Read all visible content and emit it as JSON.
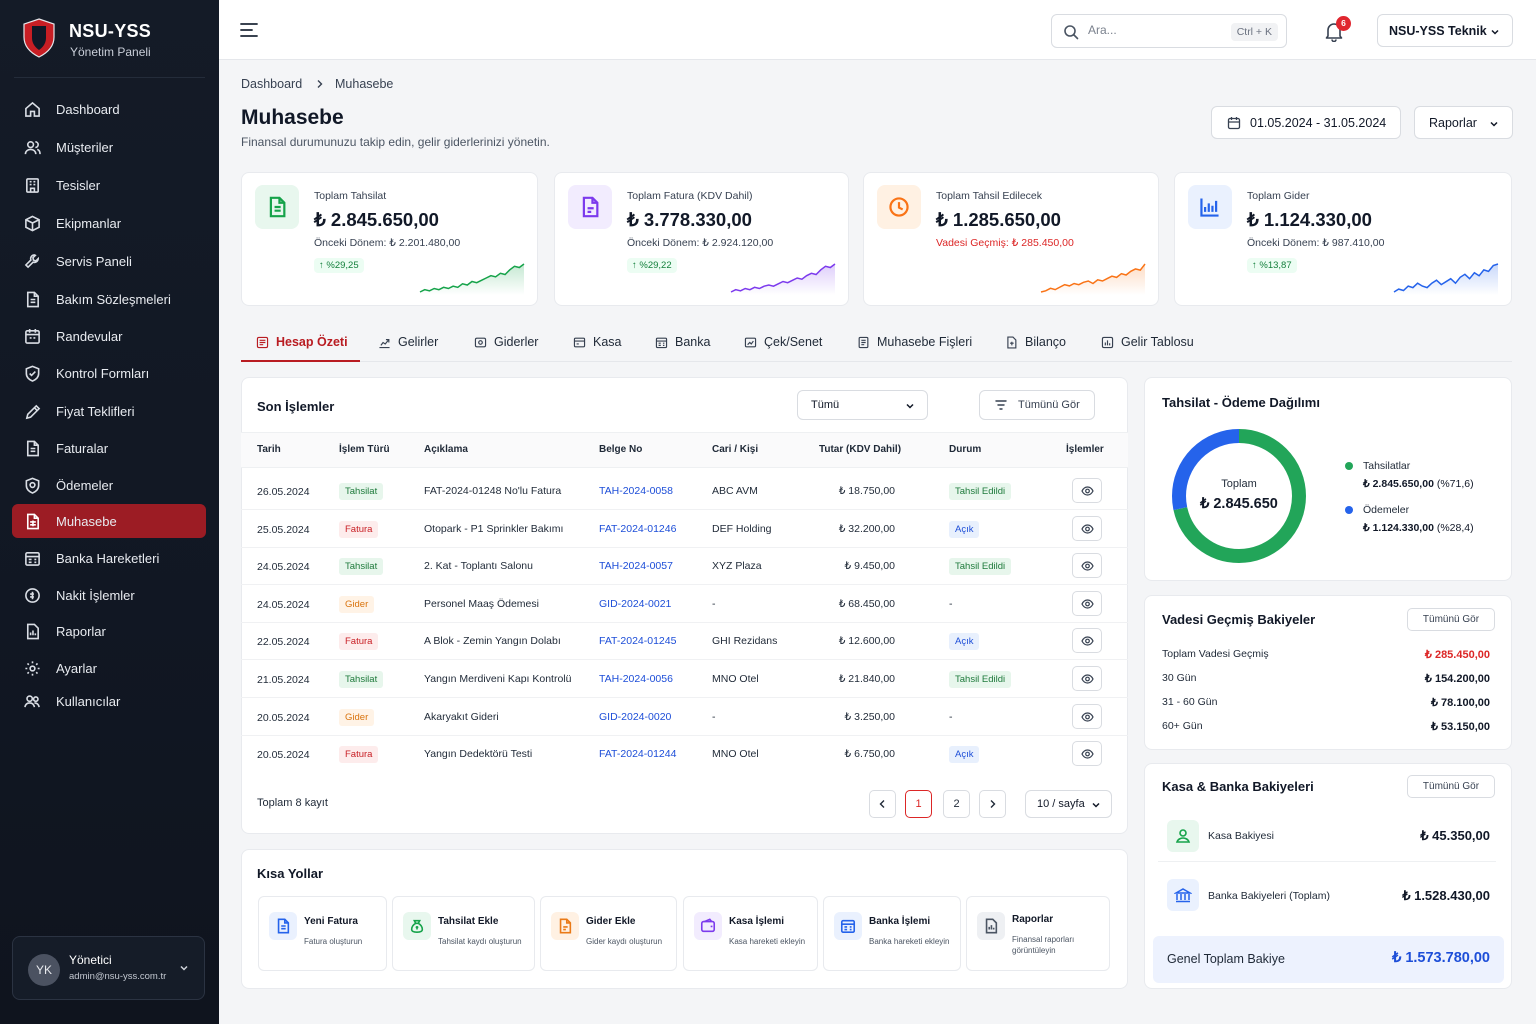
{
  "brand": {
    "name": "NSU-YSS",
    "subtitle": "Yönetim Paneli"
  },
  "sidebar": {
    "items": [
      {
        "label": "Dashboard",
        "icon": "home-icon"
      },
      {
        "label": "Müşteriler",
        "icon": "users-icon"
      },
      {
        "label": "Tesisler",
        "icon": "building-icon"
      },
      {
        "label": "Ekipmanlar",
        "icon": "box-icon"
      },
      {
        "label": "Servis Paneli",
        "icon": "wrench-icon"
      },
      {
        "label": "Bakım Sözleşmeleri",
        "icon": "contract-icon"
      },
      {
        "label": "Randevular",
        "icon": "calendar-icon"
      },
      {
        "label": "Kontrol Formları",
        "icon": "shield-check-icon"
      },
      {
        "label": "Fiyat Teklifleri",
        "icon": "quote-icon"
      },
      {
        "label": "Faturalar",
        "icon": "invoice-icon"
      },
      {
        "label": "Ödemeler",
        "icon": "payment-icon"
      },
      {
        "label": "Muhasebe",
        "icon": "accounting-icon",
        "active": true
      },
      {
        "label": "Banka Hareketleri",
        "icon": "bank-icon"
      },
      {
        "label": "Nakit İşlemler",
        "icon": "cash-icon"
      },
      {
        "label": "Raporlar",
        "icon": "report-icon"
      },
      {
        "label": "Ayarlar",
        "icon": "gear-icon"
      },
      {
        "label": "Kullanıcılar",
        "icon": "user-group-icon"
      }
    ]
  },
  "user": {
    "initials": "YK",
    "name": "Yönetici",
    "email": "admin@nsu-yss.com.tr"
  },
  "topbar": {
    "search_placeholder": "Ara...",
    "shortcut": "Ctrl + K",
    "notifications": "6",
    "account": "NSU-YSS Teknik"
  },
  "breadcrumb": {
    "root": "Dashboard",
    "current": "Muhasebe"
  },
  "page": {
    "title": "Muhasebe",
    "subtitle": "Finansal durumunuzu takip edin, gelir giderlerinizi yönetin.",
    "date_range": "01.05.2024 - 31.05.2024",
    "reports_label": "Raporlar"
  },
  "kpis": [
    {
      "label": "Toplam Tahsilat",
      "value": "₺ 2.845.650,00",
      "prev_label": "Önceki Dönem:",
      "prev_value": "₺ 2.201.480,00",
      "delta": "%29,25",
      "color": "#16a34a",
      "spark": [
        4,
        6,
        5,
        7,
        6,
        8,
        7,
        9,
        8,
        11,
        10,
        13,
        12,
        14,
        16,
        18,
        17,
        20,
        19,
        23,
        26,
        25,
        28
      ]
    },
    {
      "label": "Toplam Fatura (KDV Dahil)",
      "value": "₺ 3.778.330,00",
      "prev_label": "Önceki Dönem:",
      "prev_value": "₺ 2.924.120,00",
      "delta": "%29,22",
      "color": "#7c3aed",
      "spark": [
        3,
        5,
        4,
        6,
        5,
        7,
        6,
        8,
        9,
        8,
        10,
        12,
        11,
        13,
        15,
        14,
        17,
        19,
        18,
        22,
        25,
        24,
        27
      ]
    },
    {
      "label": "Toplam Tahsil Edilecek",
      "value": "₺ 1.285.650,00",
      "prev_label": "Vadesi Geçmiş:",
      "prev_value": "₺ 285.450,00",
      "delta": "",
      "color": "#f97316",
      "spark": [
        3,
        4,
        6,
        5,
        7,
        9,
        8,
        10,
        9,
        11,
        12,
        10,
        13,
        12,
        14,
        16,
        15,
        18,
        17,
        20,
        22,
        21,
        26
      ]
    },
    {
      "label": "Toplam Gider",
      "value": "₺ 1.124.330,00",
      "prev_label": "Önceki Dönem:",
      "prev_value": "₺ 987.410,00",
      "delta": "%13,87",
      "color": "#2563eb",
      "spark": [
        6,
        8,
        7,
        10,
        9,
        12,
        10,
        9,
        12,
        14,
        11,
        13,
        15,
        12,
        16,
        18,
        15,
        19,
        17,
        21,
        20,
        24,
        25
      ]
    }
  ],
  "tabs": [
    {
      "label": "Hesap Özeti",
      "icon": "summary-icon",
      "active": true
    },
    {
      "label": "Gelirler",
      "icon": "income-icon"
    },
    {
      "label": "Giderler",
      "icon": "expense-icon"
    },
    {
      "label": "Kasa",
      "icon": "safe-icon"
    },
    {
      "label": "Banka",
      "icon": "bank-icon"
    },
    {
      "label": "Çek/Senet",
      "icon": "check-icon"
    },
    {
      "label": "Muhasebe Fişleri",
      "icon": "voucher-icon"
    },
    {
      "label": "Bilanço",
      "icon": "balance-icon"
    },
    {
      "label": "Gelir Tablosu",
      "icon": "income-statement-icon"
    }
  ],
  "transactions": {
    "title": "Son İşlemler",
    "filter_value": "Tümü",
    "view_all": "Tümünü Gör",
    "columns": [
      "Tarih",
      "İşlem Türü",
      "Açıklama",
      "Belge No",
      "Cari / Kişi",
      "Tutar (KDV Dahil)",
      "Durum",
      "İşlemler"
    ],
    "rows": [
      {
        "date": "26.05.2024",
        "type": "Tahsilat",
        "type_color": "green",
        "desc": "FAT-2024-01248 No'lu Fatura",
        "doc": "TAH-2024-0058",
        "party": "ABC AVM",
        "amount": "₺ 18.750,00",
        "status": "Tahsil Edildi",
        "status_color": "green"
      },
      {
        "date": "25.05.2024",
        "type": "Fatura",
        "type_color": "red",
        "desc": "Otopark - P1 Sprinkler Bakımı",
        "doc": "FAT-2024-01246",
        "party": "DEF Holding",
        "amount": "₺ 32.200,00",
        "status": "Açık",
        "status_color": "blue"
      },
      {
        "date": "24.05.2024",
        "type": "Tahsilat",
        "type_color": "green",
        "desc": "2. Kat - Toplantı Salonu",
        "doc": "TAH-2024-0057",
        "party": "XYZ Plaza",
        "amount": "₺ 9.450,00",
        "status": "Tahsil Edildi",
        "status_color": "green"
      },
      {
        "date": "24.05.2024",
        "type": "Gider",
        "type_color": "orange",
        "desc": "Personel Maaş Ödemesi",
        "doc": "GID-2024-0021",
        "party": "-",
        "amount": "₺ 68.450,00",
        "status": "-",
        "status_color": ""
      },
      {
        "date": "22.05.2024",
        "type": "Fatura",
        "type_color": "red",
        "desc": "A Blok - Zemin Yangın Dolabı",
        "doc": "FAT-2024-01245",
        "party": "GHI Rezidans",
        "amount": "₺ 12.600,00",
        "status": "Açık",
        "status_color": "blue"
      },
      {
        "date": "21.05.2024",
        "type": "Tahsilat",
        "type_color": "green",
        "desc": "Yangın Merdiveni Kapı Kontrolü",
        "doc": "TAH-2024-0056",
        "party": "MNO Otel",
        "amount": "₺ 21.840,00",
        "status": "Tahsil Edildi",
        "status_color": "green"
      },
      {
        "date": "20.05.2024",
        "type": "Gider",
        "type_color": "orange",
        "desc": "Akaryakıt Gideri",
        "doc": "GID-2024-0020",
        "party": "-",
        "amount": "₺ 3.250,00",
        "status": "-",
        "status_color": ""
      },
      {
        "date": "20.05.2024",
        "type": "Fatura",
        "type_color": "red",
        "desc": "Yangın Dedektörü Testi",
        "doc": "FAT-2024-01244",
        "party": "MNO Otel",
        "amount": "₺ 6.750,00",
        "status": "Açık",
        "status_color": "blue"
      }
    ],
    "total_label": "Toplam 8 kayıt",
    "pages": [
      "1",
      "2"
    ],
    "page_size": "10 / sayfa"
  },
  "shortcuts": {
    "title": "Kısa Yollar",
    "items": [
      {
        "title": "Yeni Fatura",
        "desc": "Fatura oluşturun",
        "icon": "invoice-icon",
        "color": "#2563eb",
        "bg": "#eaf1fe"
      },
      {
        "title": "Tahsilat Ekle",
        "desc": "Tahsilat kaydı oluşturun",
        "icon": "money-bag-icon",
        "color": "#16a34a",
        "bg": "#e8f7ee"
      },
      {
        "title": "Gider Ekle",
        "desc": "Gider kaydı oluşturun",
        "icon": "expense-doc-icon",
        "color": "#ea7a17",
        "bg": "#fff1e3"
      },
      {
        "title": "Kasa İşlemi",
        "desc": "Kasa hareketi ekleyin",
        "icon": "wallet-icon",
        "color": "#7c3aed",
        "bg": "#f2ecfe"
      },
      {
        "title": "Banka İşlemi",
        "desc": "Banka hareketi ekleyin",
        "icon": "bank-icon",
        "color": "#2563eb",
        "bg": "#eaf1fe"
      },
      {
        "title": "Raporlar",
        "desc": "Finansal raporları görüntüleyin",
        "icon": "report-icon",
        "color": "#4b5563",
        "bg": "#eef0f3"
      }
    ]
  },
  "distribution": {
    "title": "Tahsilat - Ödeme Dağılımı",
    "center_label": "Toplam",
    "center_value": "₺ 2.845.650",
    "chart_data": {
      "type": "pie",
      "categories": [
        "Tahsilatlar",
        "Ödemeler"
      ],
      "values": [
        71.6,
        28.4
      ],
      "colors": [
        "#22a559",
        "#2563eb"
      ]
    },
    "legend": [
      {
        "name": "Tahsilatlar",
        "amount": "₺ 2.845.650,00",
        "pct": "(%71,6)",
        "color": "#22a559"
      },
      {
        "name": "Ödemeler",
        "amount": "₺ 1.124.330,00",
        "pct": "(%28,4)",
        "color": "#2563eb"
      }
    ]
  },
  "overdue": {
    "title": "Vadesi Geçmiş Bakiyeler",
    "view_all": "Tümünü Gör",
    "rows": [
      {
        "label": "Toplam Vadesi Geçmiş",
        "value": "₺ 285.450,00",
        "red": true
      },
      {
        "label": "30 Gün",
        "value": "₺ 154.200,00"
      },
      {
        "label": "31 - 60 Gün",
        "value": "₺ 78.100,00"
      },
      {
        "label": "60+ Gün",
        "value": "₺ 53.150,00"
      }
    ]
  },
  "balances": {
    "title": "Kasa & Banka Bakiyeleri",
    "view_all": "Tümünü Gör",
    "cash_label": "Kasa Bakiyesi",
    "cash_value": "₺ 45.350,00",
    "bank_label": "Banka Bakiyeleri (Toplam)",
    "bank_value": "₺ 1.528.430,00",
    "total_label": "Genel Toplam Bakiye",
    "total_value": "₺ 1.573.780,00"
  }
}
